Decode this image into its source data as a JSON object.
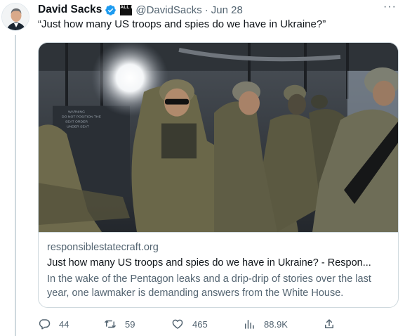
{
  "tweet": {
    "display_name": "David Sacks",
    "affiliate_badge": "ALL IN",
    "handle": "@DavidSacks",
    "separator": "·",
    "date": "Jun 28",
    "more_label": "···",
    "text": "“Just how many US troops and spies do we have in Ukraine?”"
  },
  "card": {
    "domain": "responsiblestatecraft.org",
    "title": "Just how many US troops and spies do we have in Ukraine? - Respon...",
    "description": "In the wake of the Pentagon leaks and a drip-drip of stories over the last year, one lawmaker is demanding answers from the White House.",
    "image_text": "WARNING DO NOT POSITION THE SEAT ORDER UNDER SEAT"
  },
  "actions": {
    "replies": "44",
    "retweets": "59",
    "likes": "465",
    "views": "88.9K"
  },
  "colors": {
    "verified": "#1d9bf0",
    "secondary_text": "#536471",
    "border": "#cfd9de"
  },
  "icons": [
    "verified-badge-icon",
    "reply-icon",
    "retweet-icon",
    "like-icon",
    "views-icon",
    "share-icon",
    "more-icon"
  ]
}
